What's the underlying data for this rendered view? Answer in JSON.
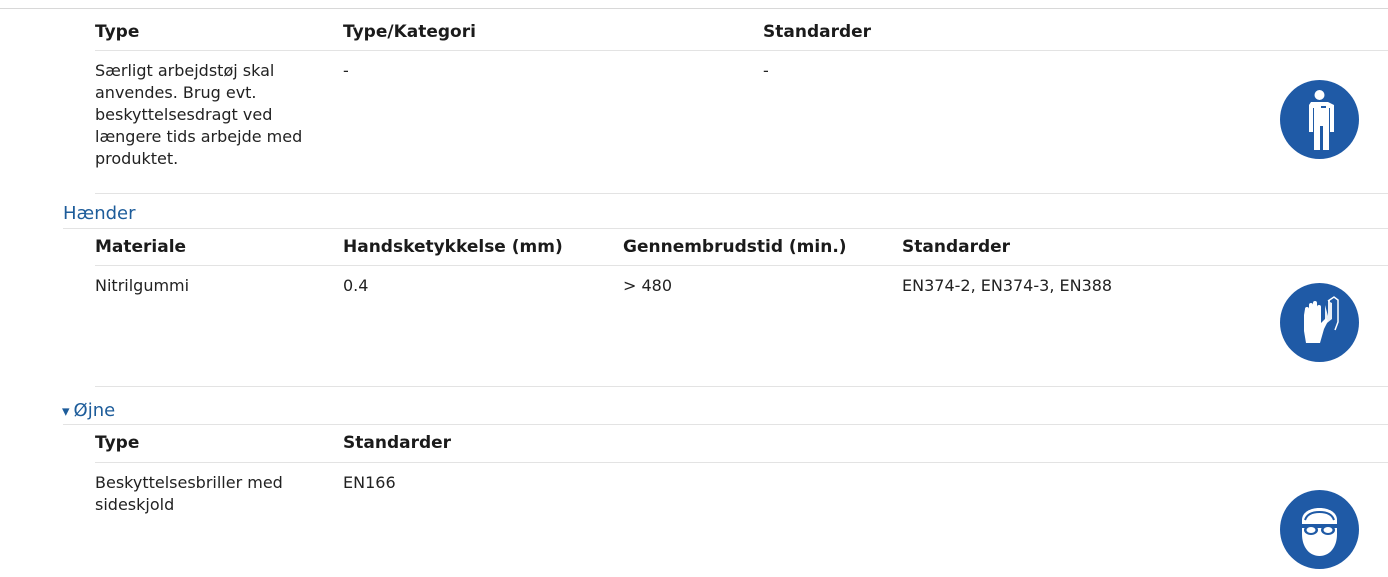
{
  "body_section": {
    "headers": [
      "Type",
      "Type/Kategori",
      "Standarder"
    ],
    "row": {
      "type": "Særligt arbejdstøj skal anvendes. Brug evt. beskyttelsesdragt ved længere tids arbejde med produktet.",
      "kategori": "-",
      "standarder": "-"
    },
    "pictogram": "protective-clothing-icon"
  },
  "hands": {
    "title": "Hænder",
    "headers": [
      "Materiale",
      "Handsketykkelse (mm)",
      "Gennembrudstid (min.)",
      "Standarder"
    ],
    "row": {
      "materiale": "Nitrilgummi",
      "tykkelse": "0.4",
      "gennembrudstid": "> 480",
      "standarder": "EN374-2, EN374-3, EN388"
    },
    "pictogram": "gloves-icon"
  },
  "eyes": {
    "toggle": "▾",
    "title": "Øjne",
    "headers": [
      "Type",
      "Standarder"
    ],
    "row": {
      "type": "Beskyttelsesbriller med sideskjold",
      "standarder": "EN166"
    },
    "pictogram": "safety-glasses-icon"
  },
  "colors": {
    "accent": "#1d5c9a",
    "pictogram_blue": "#1f5aa6",
    "divider": "#e3e3e3"
  }
}
